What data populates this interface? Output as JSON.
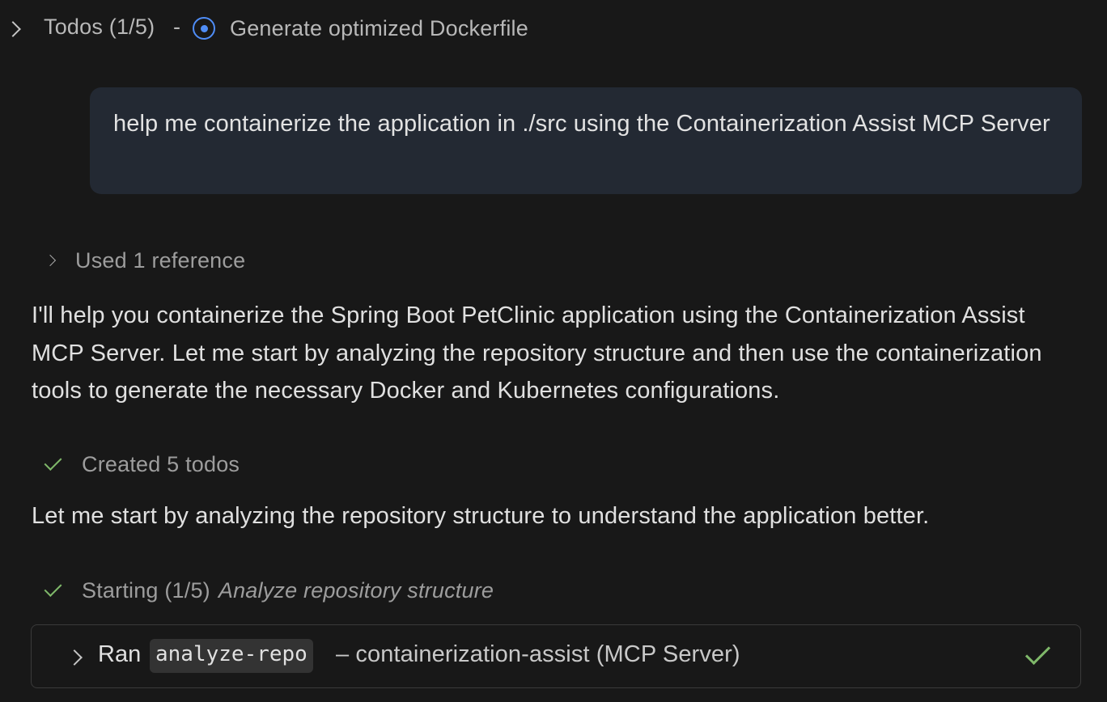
{
  "todos_header": {
    "title": "Todos (1/5)",
    "separator": "-",
    "current_task": "Generate optimized Dockerfile",
    "status_icon": "in-progress-circle-icon",
    "accent_color": "#4f8df7"
  },
  "user_message": {
    "text": "help me containerize the application in ./src using the Containerization Assist MCP Server"
  },
  "references": {
    "label": "Used 1 reference"
  },
  "response": {
    "paragraph1": "I'll help you containerize the Spring Boot PetClinic application using the Containerization Assist MCP Server. Let me start by analyzing the repository structure and then use the containerization tools to generate the necessary Docker and Kubernetes configurations.",
    "created_todos": "Created 5 todos",
    "paragraph2": "Let me start by analyzing the repository structure to understand the application better.",
    "starting_label": "Starting (1/5)",
    "starting_task": "Analyze repository structure"
  },
  "tool_call": {
    "ran_label": "Ran",
    "tool_name": "analyze-repo",
    "description": "– containerization-assist (MCP Server)",
    "status_color": "#7fb86a"
  }
}
